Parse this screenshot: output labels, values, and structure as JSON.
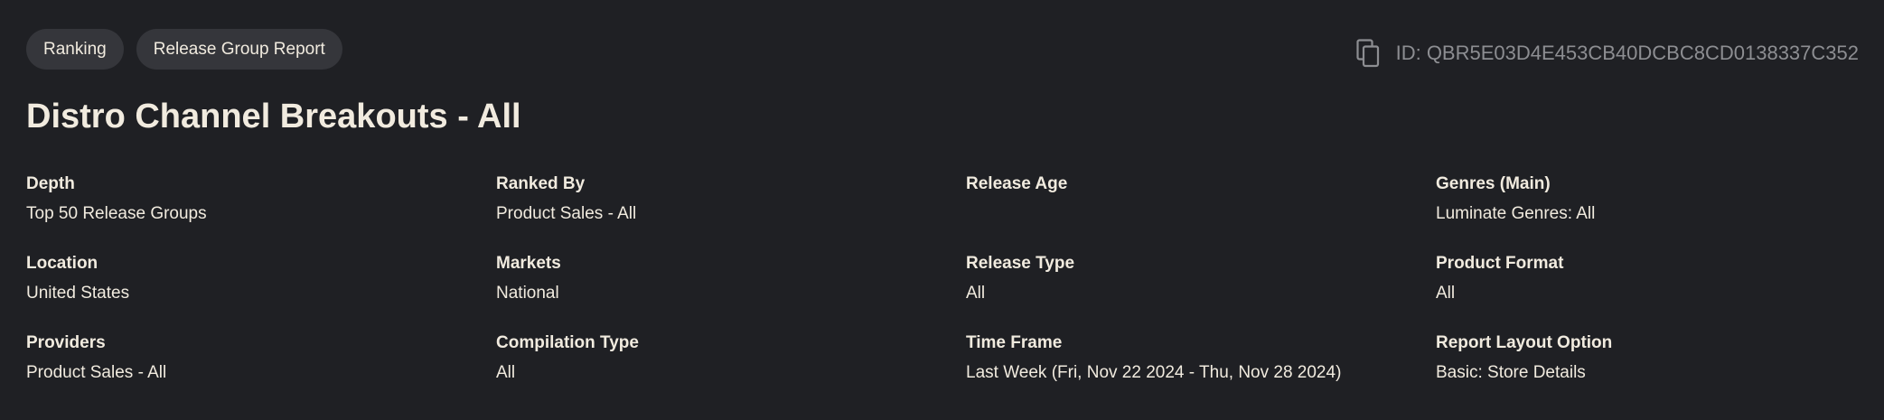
{
  "tags": [
    "Ranking",
    "Release Group Report"
  ],
  "report_id": "ID: QBR5E03D4E453CB40DCBC8CD0138337C352",
  "title": "Distro Channel Breakouts - All",
  "fields": [
    {
      "label": "Depth",
      "value": "Top 50 Release Groups"
    },
    {
      "label": "Ranked By",
      "value": "Product Sales - All"
    },
    {
      "label": "Release Age",
      "value": ""
    },
    {
      "label": "Genres (Main)",
      "value": "Luminate Genres: All"
    },
    {
      "label": "Location",
      "value": "United States"
    },
    {
      "label": "Markets",
      "value": "National"
    },
    {
      "label": "Release Type",
      "value": "All"
    },
    {
      "label": "Product Format",
      "value": "All"
    },
    {
      "label": "Providers",
      "value": "Product Sales - All"
    },
    {
      "label": "Compilation Type",
      "value": "All"
    },
    {
      "label": "Time Frame",
      "value": "Last Week (Fri, Nov 22 2024 - Thu, Nov 28 2024)"
    },
    {
      "label": "Report Layout Option",
      "value": "Basic: Store Details"
    }
  ],
  "icons": {
    "copy": "copy-icon"
  },
  "colors": {
    "background": "#1f2024",
    "text": "#f1ebdf",
    "tag_bg": "#35363b",
    "muted": "#8d8e92"
  }
}
